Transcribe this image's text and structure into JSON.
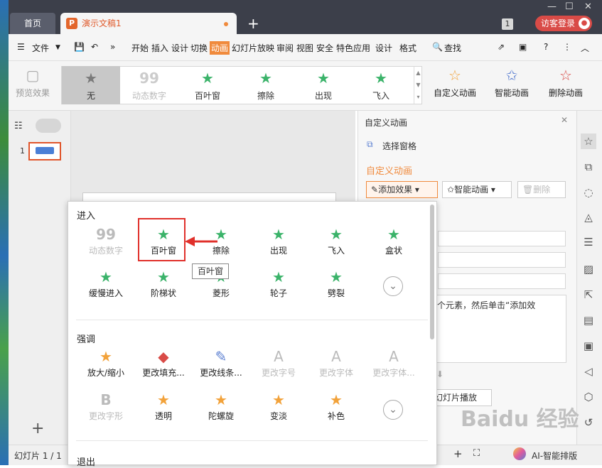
{
  "titlebar": {
    "home_tab": "首页",
    "doc_tab": "演示文稿1",
    "doc_logo": "P",
    "new_tab": "+",
    "badge": "1",
    "login": "访客登录"
  },
  "menubar": {
    "file": "文件",
    "items": [
      "开始",
      "插入",
      "设计",
      "切换",
      "动画",
      "幻灯片放映",
      "审阅",
      "视图",
      "安全",
      "特色应用",
      "设计",
      "格式"
    ],
    "active": "动画",
    "search": "查找"
  },
  "ribbon": {
    "preview": "预览效果",
    "gallery": [
      {
        "label": "无",
        "icon": "star-gray-icon"
      },
      {
        "label": "动态数字",
        "icon": "number-icon"
      },
      {
        "label": "百叶窗",
        "icon": "star-green-icon"
      },
      {
        "label": "擦除",
        "icon": "star-green-icon"
      },
      {
        "label": "出现",
        "icon": "star-green-icon"
      },
      {
        "label": "飞入",
        "icon": "star-green-icon"
      }
    ],
    "custom_anim": "自定义动画",
    "smart_anim": "智能动画",
    "delete_anim": "删除动画"
  },
  "left_pane": {
    "slide_number": "1"
  },
  "right_pane": {
    "title": "自定义动画",
    "select_pane": "选择窗格",
    "section_title": "自定义动画",
    "add_effect": "添加效果",
    "smart_anim": "智能动画",
    "delete": "删除",
    "hint": "个元素，然后单击“添加效",
    "play": "幻灯片播放"
  },
  "popup": {
    "sections": [
      {
        "title": "进入",
        "items": [
          {
            "label": "动态数字",
            "icon": "number-icon",
            "disabled": true
          },
          {
            "label": "百叶窗",
            "icon": "star-green-icon",
            "disabled": false
          },
          {
            "label": "擦除",
            "icon": "star-green-icon",
            "disabled": false
          },
          {
            "label": "出现",
            "icon": "star-green-icon",
            "disabled": false
          },
          {
            "label": "飞入",
            "icon": "star-green-icon",
            "disabled": false
          },
          {
            "label": "盒状",
            "icon": "star-green-icon",
            "disabled": false
          },
          {
            "label": "缓慢进入",
            "icon": "star-green-icon",
            "disabled": false
          },
          {
            "label": "阶梯状",
            "icon": "star-green-icon",
            "disabled": false
          },
          {
            "label": "菱形",
            "icon": "star-green-icon",
            "disabled": false
          },
          {
            "label": "轮子",
            "icon": "star-green-icon",
            "disabled": false
          },
          {
            "label": "劈裂",
            "icon": "star-green-icon",
            "disabled": false
          }
        ]
      },
      {
        "title": "强调",
        "items": [
          {
            "label": "放大/缩小",
            "icon": "star-orange-icon",
            "disabled": false
          },
          {
            "label": "更改填充...",
            "icon": "fill-icon",
            "disabled": false
          },
          {
            "label": "更改线条...",
            "icon": "line-icon",
            "disabled": false
          },
          {
            "label": "更改字号",
            "icon": "font-size-icon",
            "disabled": true
          },
          {
            "label": "更改字体",
            "icon": "font-icon",
            "disabled": true
          },
          {
            "label": "更改字体...",
            "icon": "font-icon",
            "disabled": true
          },
          {
            "label": "更改字形",
            "icon": "bold-icon",
            "disabled": true
          },
          {
            "label": "透明",
            "icon": "star-orange-icon",
            "disabled": false
          },
          {
            "label": "陀螺旋",
            "icon": "star-orange-icon",
            "disabled": false
          },
          {
            "label": "变淡",
            "icon": "star-orange-icon",
            "disabled": false
          },
          {
            "label": "补色",
            "icon": "star-orange-icon",
            "disabled": false
          }
        ]
      },
      {
        "title": "退出",
        "items": []
      }
    ],
    "tooltip": "百叶窗"
  },
  "statusbar": {
    "slide_info": "幻灯片 1 / 1",
    "ai_label": "AI-智能排版"
  },
  "watermark": "Baidu 经验",
  "colors": {
    "accent": "#f08a3c",
    "highlight": "#e0302b",
    "titlebar": "#3c3f4a",
    "green_star": "#3bb36a"
  }
}
